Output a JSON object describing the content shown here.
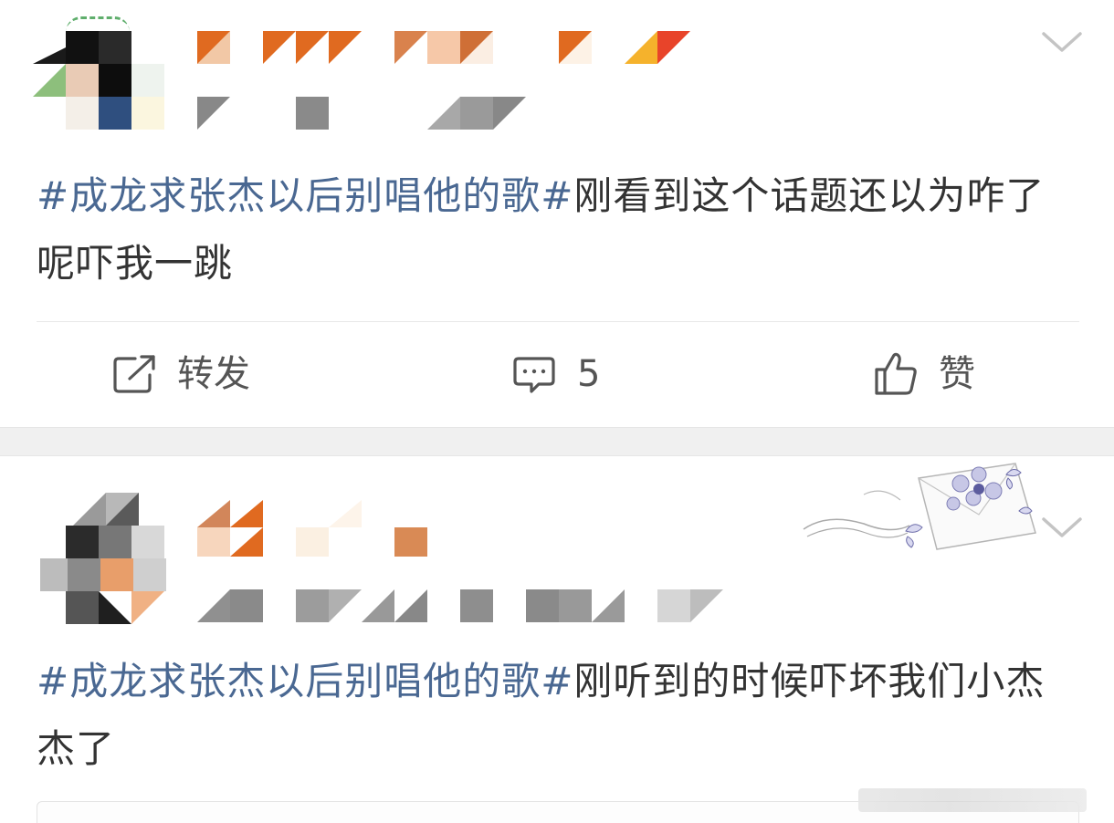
{
  "posts": [
    {
      "hashtag": "#成龙求张杰以后别唱他的歌#",
      "body": "刚看到这个话题还以为咋了呢吓我一跳",
      "actions": {
        "repost_label": "转发",
        "comment_count": "5",
        "like_label": "赞"
      }
    },
    {
      "hashtag": "#成龙求张杰以后别唱他的歌#",
      "body": "刚听到的时候吓坏我们小杰杰了"
    }
  ],
  "colors": {
    "hashtag": "#4a6892",
    "body_text": "#333333",
    "action_text": "#555555",
    "separator": "#f0f0f0"
  },
  "icons": {
    "expand": "chevron-down-icon",
    "repost": "repost-icon",
    "comment": "comment-icon",
    "like": "thumbs-up-icon",
    "card_decoration": "envelope-flower-butterfly-decoration"
  }
}
